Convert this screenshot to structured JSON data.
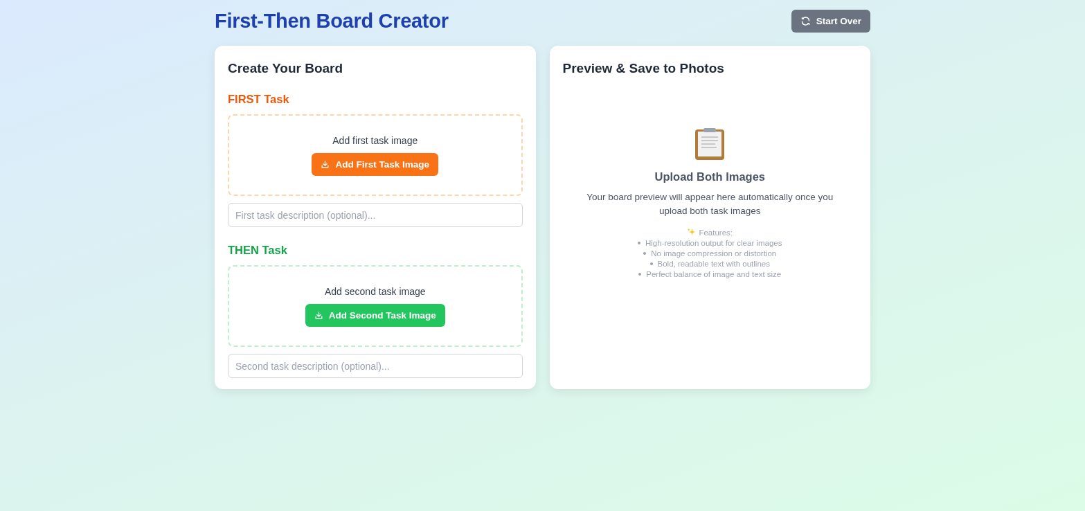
{
  "header": {
    "title": "First-Then Board Creator",
    "start_over": "Start Over"
  },
  "create_panel": {
    "title": "Create Your Board",
    "tasks": [
      {
        "kind": "first",
        "heading": "FIRST Task",
        "prompt": "Add first task image",
        "button": "Add First Task Image",
        "placeholder": "First task description (optional)..."
      },
      {
        "kind": "then",
        "heading": "THEN Task",
        "prompt": "Add second task image",
        "button": "Add Second Task Image",
        "placeholder": "Second task description (optional)..."
      }
    ]
  },
  "preview_panel": {
    "title": "Preview & Save to Photos",
    "empty_title": "Upload Both Images",
    "empty_text": "Your board preview will appear here automatically once you upload both task images",
    "features_label": "Features:",
    "features": [
      "High-resolution output for clear images",
      "No image compression or distortion",
      "Bold, readable text with outlines",
      "Perfect balance of image and text size"
    ]
  }
}
